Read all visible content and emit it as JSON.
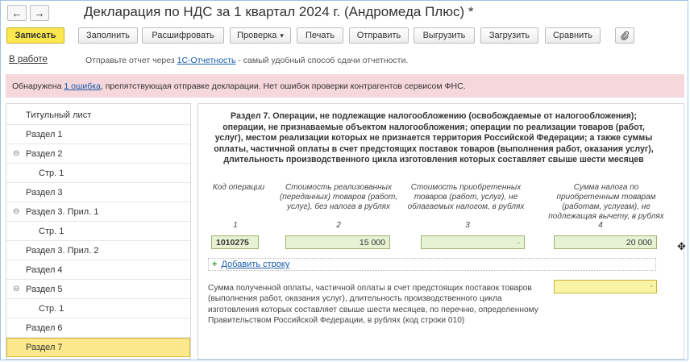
{
  "window": {
    "title": "Декларация по НДС за 1 квартал 2024 г. (Андромеда Плюс) *",
    "back_icon": "←",
    "forward_icon": "→"
  },
  "toolbar": {
    "save": "Записать",
    "fill": "Заполнить",
    "decode": "Расшифровать",
    "check": "Проверка",
    "check_arrow": "▾",
    "print": "Печать",
    "send": "Отправить",
    "unload": "Выгрузить",
    "load": "Загрузить",
    "compare": "Сравнить",
    "attach_icon": "📎"
  },
  "status": {
    "label": "В работе",
    "hint_prefix": "Отправьте отчет через ",
    "hint_link": "1С-Отчетность",
    "hint_suffix": " - самый удобный способ сдачи отчетности."
  },
  "error_bar": {
    "prefix": "Обнаружена ",
    "link": "1 ошибка",
    "suffix": ", препятствующая отправке декларации. Нет ошибок проверки контрагентов сервисом ФНС."
  },
  "tree": {
    "items": [
      {
        "label": "Титульный лист",
        "toggle": ""
      },
      {
        "label": "Раздел 1",
        "toggle": ""
      },
      {
        "label": "Раздел 2",
        "toggle": "⊖"
      },
      {
        "label": "Стр. 1",
        "toggle": ""
      },
      {
        "label": "Раздел 3",
        "toggle": ""
      },
      {
        "label": "Раздел 3. Прил. 1",
        "toggle": "⊖"
      },
      {
        "label": "Стр. 1",
        "toggle": ""
      },
      {
        "label": "Раздел 3. Прил. 2",
        "toggle": ""
      },
      {
        "label": "Раздел 4",
        "toggle": ""
      },
      {
        "label": "Раздел 5",
        "toggle": "⊖"
      },
      {
        "label": "Стр. 1",
        "toggle": ""
      },
      {
        "label": "Раздел 6",
        "toggle": ""
      },
      {
        "label": "Раздел 7",
        "toggle": ""
      }
    ],
    "selected": "Раздел 7"
  },
  "section": {
    "heading": "Раздел 7. Операции, не подлежащие налогообложению (освобождаемые от налогообложения); операции, не признаваемые объектом налогообложения; операции по реализации товаров (работ, услуг), местом реализации которых не признается территория Российской Федерации; а также суммы оплаты, частичной оплаты в счет предстоящих поставок товаров (выполнения работ, оказания услуг), длительность производственного цикла изготовления которых составляет свыше шести месяцев",
    "columns": [
      {
        "header": "Код операции",
        "num": "1"
      },
      {
        "header": "Стоимость реализованных (переданных) товаров (работ, услуг), без налога в рублях",
        "num": "2"
      },
      {
        "header": "Стоимость приобретенных товаров (работ, услуг), не облагаемых налогом, в рублях",
        "num": "3"
      },
      {
        "header": "Сумма налога по приобретенным товарам (работам, услугам), не подлежащая вычету, в рублях",
        "num": "4"
      }
    ],
    "row": {
      "code": "1010275",
      "col2": "15 000",
      "col3": "-",
      "col4": "20 000"
    },
    "add_row": "Добавить строку",
    "add_icon": "+",
    "paragraph": "Сумма полученной оплаты, частичной оплаты в счет предстоящих поставок товаров (выполнения работ, оказания услуг), длительность производственного цикла изготовления которых составляет свыше шести месяцев, по перечню, определенному Правительством Российской Федерации, в рублях (код строки 010)",
    "paragraph_value": "-"
  },
  "cursor_icon": "✥",
  "colors": {
    "primary_button": "#fbe84e",
    "error_bar": "#f5d7dc",
    "selected_item": "#fbe88d",
    "input_green": "#e7f2d3",
    "input_yellow": "#fbf4a4",
    "link": "#1a5dab"
  }
}
